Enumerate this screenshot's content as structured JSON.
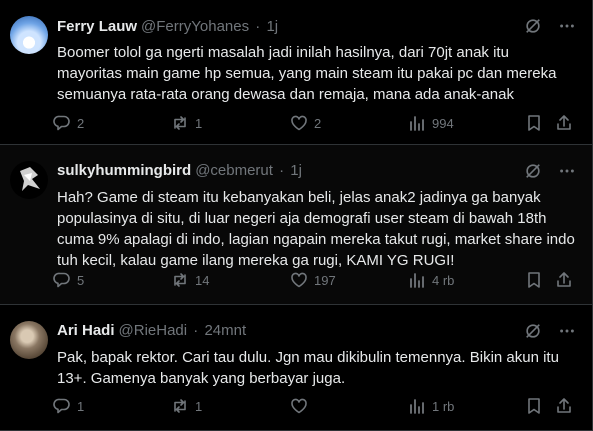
{
  "tweets": [
    {
      "name": "Ferry Lauw",
      "handle": "@FerryYohanes",
      "time": "1j",
      "text": "Boomer tolol ga ngerti masalah jadi inilah hasilnya, dari 70jt anak itu mayoritas main game hp semua, yang main steam itu pakai pc dan mereka semuanya rata-rata orang dewasa dan remaja, mana ada anak-anak",
      "replies": "2",
      "reposts": "1",
      "likes": "2",
      "views": "994"
    },
    {
      "name": "sulkyhummingbird",
      "handle": "@cebmerut",
      "time": "1j",
      "text": "Hah? Game di steam itu kebanyakan beli, jelas anak2 jadinya ga banyak populasinya di situ, di luar negeri aja demografi user steam di bawah 18th cuma 9% apalagi di indo, lagian ngapain mereka takut rugi, market share indo tuh kecil, kalau game ilang mereka ga rugi, KAMI YG RUGI!",
      "replies": "5",
      "reposts": "14",
      "likes": "197",
      "views": "4 rb"
    },
    {
      "name": "Ari Hadi",
      "handle": "@RieHadi",
      "time": "24mnt",
      "text": "Pak, bapak rektor. Cari tau dulu. Jgn mau dikibulin temennya. Bikin akun itu 13+. Gamenya banyak yang berbayar juga.",
      "replies": "1",
      "reposts": "1",
      "likes": "",
      "views": "1 rb"
    }
  ],
  "separator": "·",
  "icons": [
    "grok-icon",
    "more-icon",
    "reply-icon",
    "repost-icon",
    "like-icon",
    "views-icon",
    "bookmark-icon",
    "share-icon"
  ]
}
